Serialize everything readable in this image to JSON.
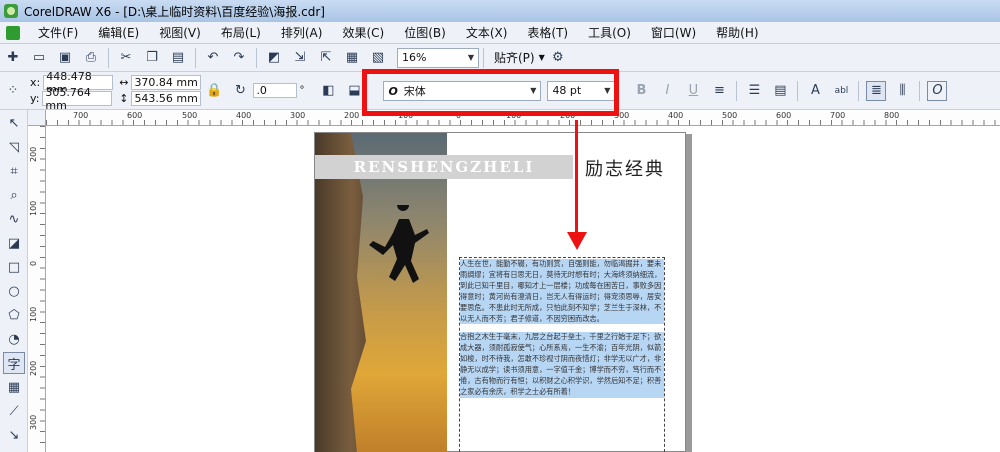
{
  "window": {
    "title": "CorelDRAW X6 - [D:\\桌上临时资料\\百度经验\\海报.cdr]"
  },
  "menu": [
    "文件(F)",
    "编辑(E)",
    "视图(V)",
    "布局(L)",
    "排列(A)",
    "效果(C)",
    "位图(B)",
    "文本(X)",
    "表格(T)",
    "工具(O)",
    "窗口(W)",
    "帮助(H)"
  ],
  "toolbar": {
    "zoom": "16%",
    "snap": "贴齐(P)"
  },
  "props": {
    "x": "448.478 mm",
    "y": "305.764 mm",
    "width": "370.84 mm",
    "height": "543.56 mm",
    "angle": ".0",
    "angle_unit": "°",
    "font_name": "宋体",
    "font_size": "48 pt",
    "x_label": "x:",
    "y_label": "y:"
  },
  "ruler": {
    "h_ticks": [
      "700",
      "600",
      "500",
      "400",
      "300",
      "200",
      "100",
      "0",
      "100",
      "200",
      "300",
      "400",
      "500",
      "600",
      "700",
      "800"
    ],
    "v_ticks": [
      "200",
      "100",
      "0",
      "100",
      "200",
      "300"
    ]
  },
  "poster": {
    "banner": "RENSHENGZHELI",
    "title": "励志经典",
    "paragraph1": "人生在世，能勤不辍，有功则赏，自强则能，勿临渴掘井，要未雨绸缪；宜将有日思无日，莫待无时想有时；大海终须纳细流，到此已知千里目，哪知才上一层楼；功成每在困苦日，事败多因得意时；黄河尚有澄清日，岂无人有得运时；得宠须思辱，居安要思危。不患此时无所成，只怕此刻不知学；芝兰生于深林，不以无人而不芳；君子修道，不因穷困而改志。",
    "paragraph2": "合抱之木生于毫末，九层之台起于垒土，千里之行始于足下；欲成大器，须耐孤寂使气；心所系焉，一生不渝；百年光阴，似箭如梭，时不待我，怎敢不珍视寸阴而夜惜灯；非学无以广才，非静无以成学；读书须用意，一字值千金；博学而不穷，笃行而不倦，古有物而行有恒；以积财之心积学识，学然后知不足；积善之家必有余庆，积学之士必有所着！"
  },
  "colors": {
    "highlight": "#ee1111",
    "selection": "#b7d6f4"
  }
}
